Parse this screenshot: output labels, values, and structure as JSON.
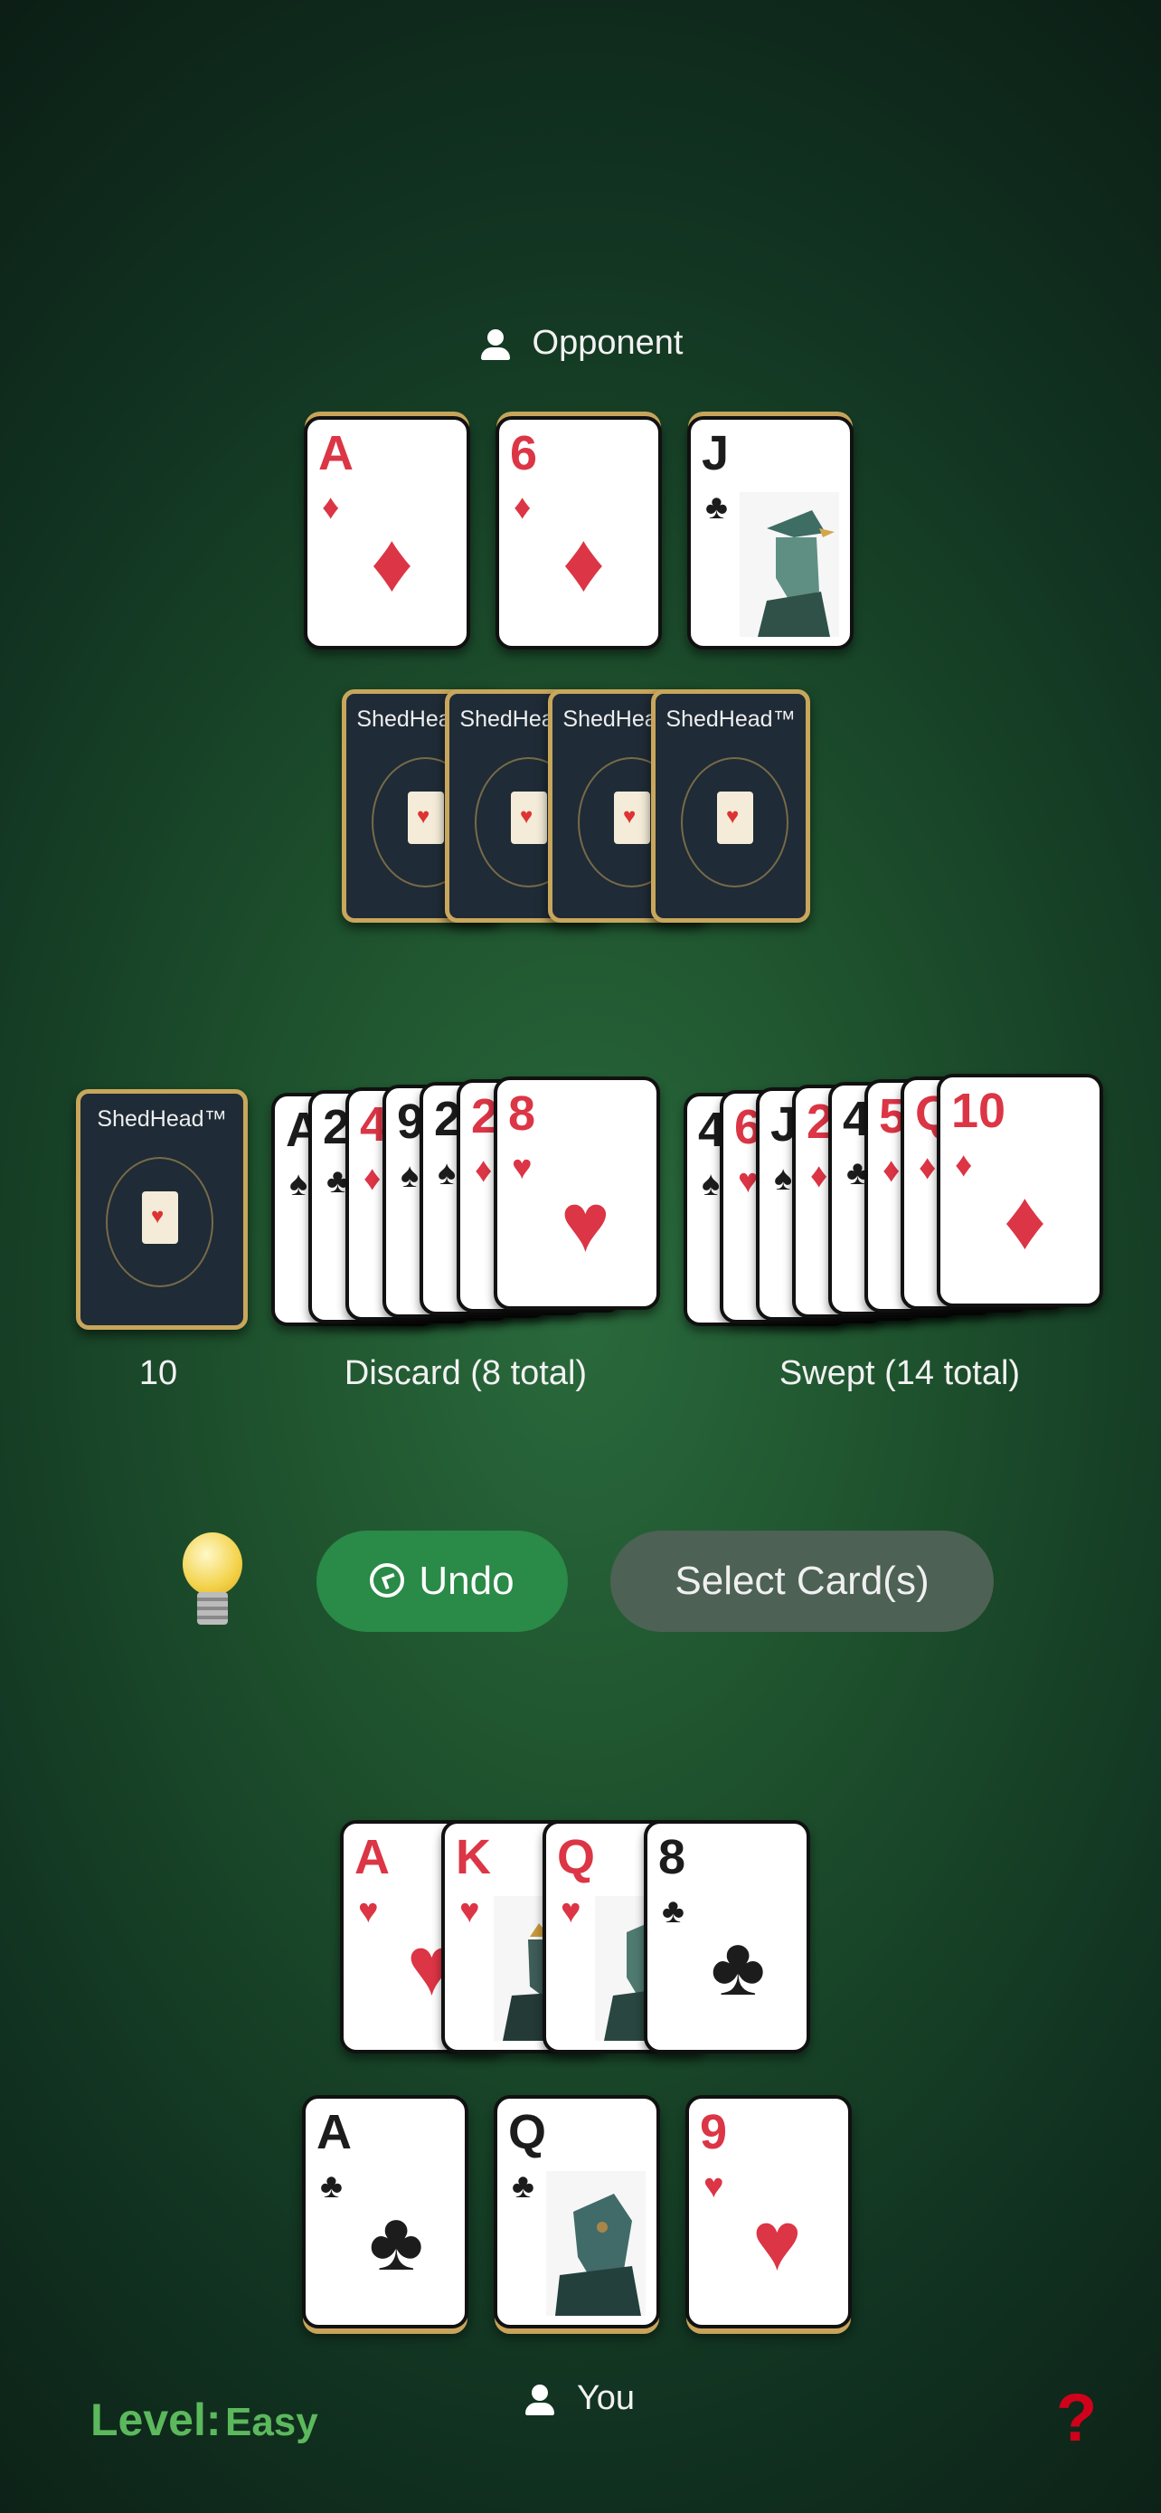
{
  "opponent": {
    "label": "Opponent",
    "face_up": [
      {
        "rank": "A",
        "suit": "♦",
        "color": "red"
      },
      {
        "rank": "6",
        "suit": "♦",
        "color": "red"
      },
      {
        "rank": "J",
        "suit": "♣",
        "color": "black"
      }
    ],
    "card_back_brand": "ShedHead™"
  },
  "piles": {
    "deck_count": "10",
    "discard_label": "Discard (8 total)",
    "discard_visible": [
      {
        "rank": "A",
        "suit": "♠",
        "color": "black"
      },
      {
        "rank": "2",
        "suit": "♣",
        "color": "black"
      },
      {
        "rank": "4",
        "suit": "♦",
        "color": "red"
      },
      {
        "rank": "9",
        "suit": "♠",
        "color": "black"
      },
      {
        "rank": "2",
        "suit": "♠",
        "color": "black"
      },
      {
        "rank": "2",
        "suit": "♦",
        "color": "red"
      },
      {
        "rank": "8",
        "suit": "♥",
        "color": "red"
      }
    ],
    "swept_label": "Swept (14 total)",
    "swept_visible": [
      {
        "rank": "4",
        "suit": "♠",
        "color": "black"
      },
      {
        "rank": "6",
        "suit": "♥",
        "color": "red"
      },
      {
        "rank": "J",
        "suit": "♠",
        "color": "black"
      },
      {
        "rank": "2",
        "suit": "♦",
        "color": "red"
      },
      {
        "rank": "4",
        "suit": "♣",
        "color": "black"
      },
      {
        "rank": "5",
        "suit": "♦",
        "color": "red"
      },
      {
        "rank": "Q",
        "suit": "♦",
        "color": "red"
      },
      {
        "rank": "10",
        "suit": "♦",
        "color": "red"
      }
    ]
  },
  "controls": {
    "hint_icon": "lightbulb-icon",
    "undo_label": "Undo",
    "select_label": "Select Card(s)"
  },
  "player": {
    "label": "You",
    "hand": [
      {
        "rank": "A",
        "suit": "♥",
        "color": "red"
      },
      {
        "rank": "K",
        "suit": "♥",
        "color": "red"
      },
      {
        "rank": "Q",
        "suit": "♥",
        "color": "red"
      },
      {
        "rank": "8",
        "suit": "♣",
        "color": "black"
      }
    ],
    "face_up": [
      {
        "rank": "A",
        "suit": "♣",
        "color": "black"
      },
      {
        "rank": "Q",
        "suit": "♣",
        "color": "black"
      },
      {
        "rank": "9",
        "suit": "♥",
        "color": "red"
      }
    ]
  },
  "footer": {
    "level_prefix": "Level:",
    "level_value": "Easy",
    "help_symbol": "?"
  },
  "colors": {
    "red_suit": "#dc3545",
    "black_suit": "#1c1c1c",
    "level_green": "#5cb85c",
    "help_red": "#d0021b",
    "undo_green": "#2a8a47"
  }
}
